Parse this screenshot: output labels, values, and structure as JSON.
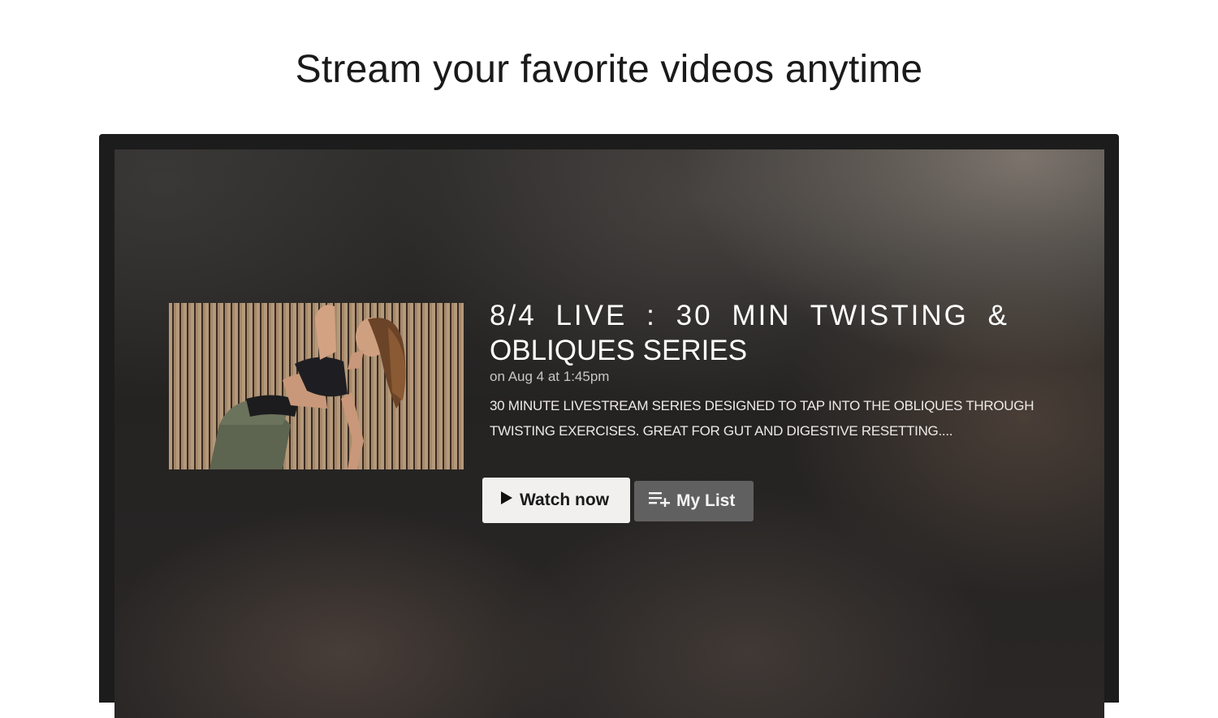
{
  "page": {
    "headline": "Stream your favorite videos anytime"
  },
  "video": {
    "thumbnail_icon": "yoga-thumbnail",
    "title_line1": "8/4 LIVE : 30 MIN TWISTING &",
    "title_line2": "OBLIQUES SERIES",
    "date": "on Aug 4 at 1:45pm",
    "description_line1": "30 MINUTE LIVESTREAM SERIES DESIGNED TO TAP INTO THE OBLIQUES THROUGH",
    "description_line2": "TWISTING EXERCISES. GREAT FOR GUT AND DIGESTIVE RESETTING...."
  },
  "actions": {
    "watch_label": "Watch now",
    "watch_icon": "play-icon",
    "list_label": "My List",
    "list_icon": "playlist-add-icon"
  },
  "colors": {
    "watch_button_bg": "#f1f0ef",
    "list_button_bg": "#616060",
    "tv_frame": "#1c1c1c"
  }
}
